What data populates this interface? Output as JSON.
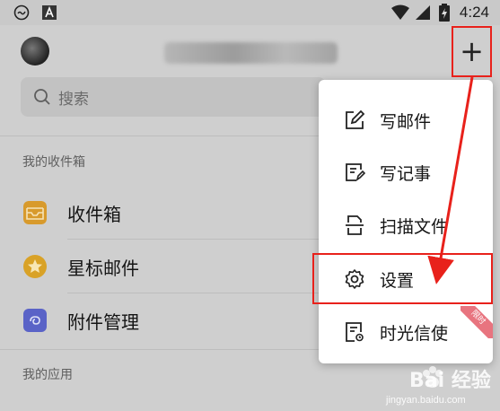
{
  "status_bar": {
    "time": "4:24",
    "icons": [
      "cloud-smile-icon",
      "a-badge-icon",
      "wifi-icon",
      "signal-icon",
      "battery-charging-icon"
    ]
  },
  "header": {
    "avatar": "avatar",
    "add_button": "+"
  },
  "search": {
    "placeholder": "搜索"
  },
  "sections": {
    "mailboxes_label": "我的收件箱",
    "apps_label": "我的应用"
  },
  "mailboxes": [
    {
      "label": "收件箱",
      "icon": "inbox-icon",
      "color": "#d89a2c"
    },
    {
      "label": "星标邮件",
      "icon": "star-icon",
      "color": "#d9a227"
    },
    {
      "label": "附件管理",
      "icon": "attachment-icon",
      "color": "#5a63c7"
    }
  ],
  "menu": {
    "items": [
      {
        "label": "写邮件",
        "icon": "compose-icon"
      },
      {
        "label": "写记事",
        "icon": "note-icon"
      },
      {
        "label": "扫描文件",
        "icon": "scan-icon"
      },
      {
        "label": "设置",
        "icon": "gear-icon"
      },
      {
        "label": "时光信使",
        "icon": "time-letter-icon"
      }
    ],
    "ribbon_label": "限时"
  },
  "annotation_color": "#e8211b",
  "watermark": {
    "text": "Bai 经验",
    "url": "jingyan.baidu.com"
  }
}
